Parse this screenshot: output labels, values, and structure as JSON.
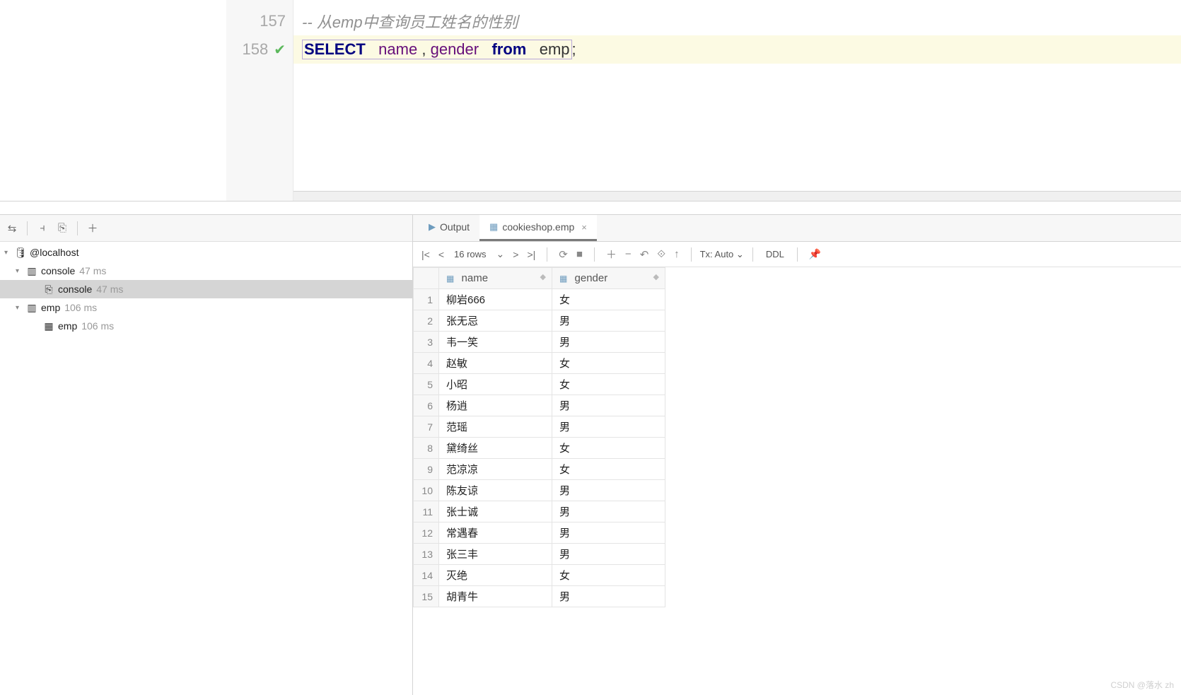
{
  "editor": {
    "lines": [
      {
        "num": "157",
        "type": "comment",
        "text": "--  从emp中查询员工姓名的性别",
        "status": ""
      },
      {
        "num": "158",
        "type": "sql",
        "status": "ok"
      }
    ],
    "sql": {
      "select": "SELECT",
      "col1": "name",
      "comma": ",",
      "col2": "gender",
      "from": "from",
      "table": "emp",
      "semi": ";"
    }
  },
  "left_toolbar": {
    "icons": [
      "filter",
      "layout",
      "window",
      "add"
    ]
  },
  "tree": {
    "root": "@localhost",
    "nodes": [
      {
        "label": "console",
        "ms": "47 ms",
        "indent": 1,
        "icon": "db",
        "exp": "▾"
      },
      {
        "label": "console",
        "ms": "47 ms",
        "indent": 2,
        "icon": "leaf",
        "sel": true
      },
      {
        "label": "emp",
        "ms": "106 ms",
        "indent": 1,
        "icon": "db",
        "exp": "▾"
      },
      {
        "label": "emp",
        "ms": "106 ms",
        "indent": 2,
        "icon": "table"
      }
    ]
  },
  "tabs": [
    {
      "label": "Output",
      "icon": "run",
      "active": false
    },
    {
      "label": "cookieshop.emp",
      "icon": "table",
      "active": true,
      "closable": true
    }
  ],
  "result_toolbar": {
    "rows_label": "16 rows",
    "tx_label": "Tx: Auto",
    "ddl": "DDL"
  },
  "columns": [
    "name",
    "gender"
  ],
  "rows": [
    {
      "n": "1",
      "name": "柳岩666",
      "gender": "女"
    },
    {
      "n": "2",
      "name": "张无忌",
      "gender": "男"
    },
    {
      "n": "3",
      "name": "韦一笑",
      "gender": "男"
    },
    {
      "n": "4",
      "name": "赵敏",
      "gender": "女"
    },
    {
      "n": "5",
      "name": "小昭",
      "gender": "女"
    },
    {
      "n": "6",
      "name": "杨逍",
      "gender": "男"
    },
    {
      "n": "7",
      "name": "范瑶",
      "gender": "男"
    },
    {
      "n": "8",
      "name": "黛绮丝",
      "gender": "女"
    },
    {
      "n": "9",
      "name": "范凉凉",
      "gender": "女"
    },
    {
      "n": "10",
      "name": "陈友谅",
      "gender": "男"
    },
    {
      "n": "11",
      "name": "张士诚",
      "gender": "男"
    },
    {
      "n": "12",
      "name": "常遇春",
      "gender": "男"
    },
    {
      "n": "13",
      "name": "张三丰",
      "gender": "男"
    },
    {
      "n": "14",
      "name": "灭绝",
      "gender": "女"
    },
    {
      "n": "15",
      "name": "胡青牛",
      "gender": "男"
    }
  ],
  "watermark": "CSDN @落水 zh"
}
